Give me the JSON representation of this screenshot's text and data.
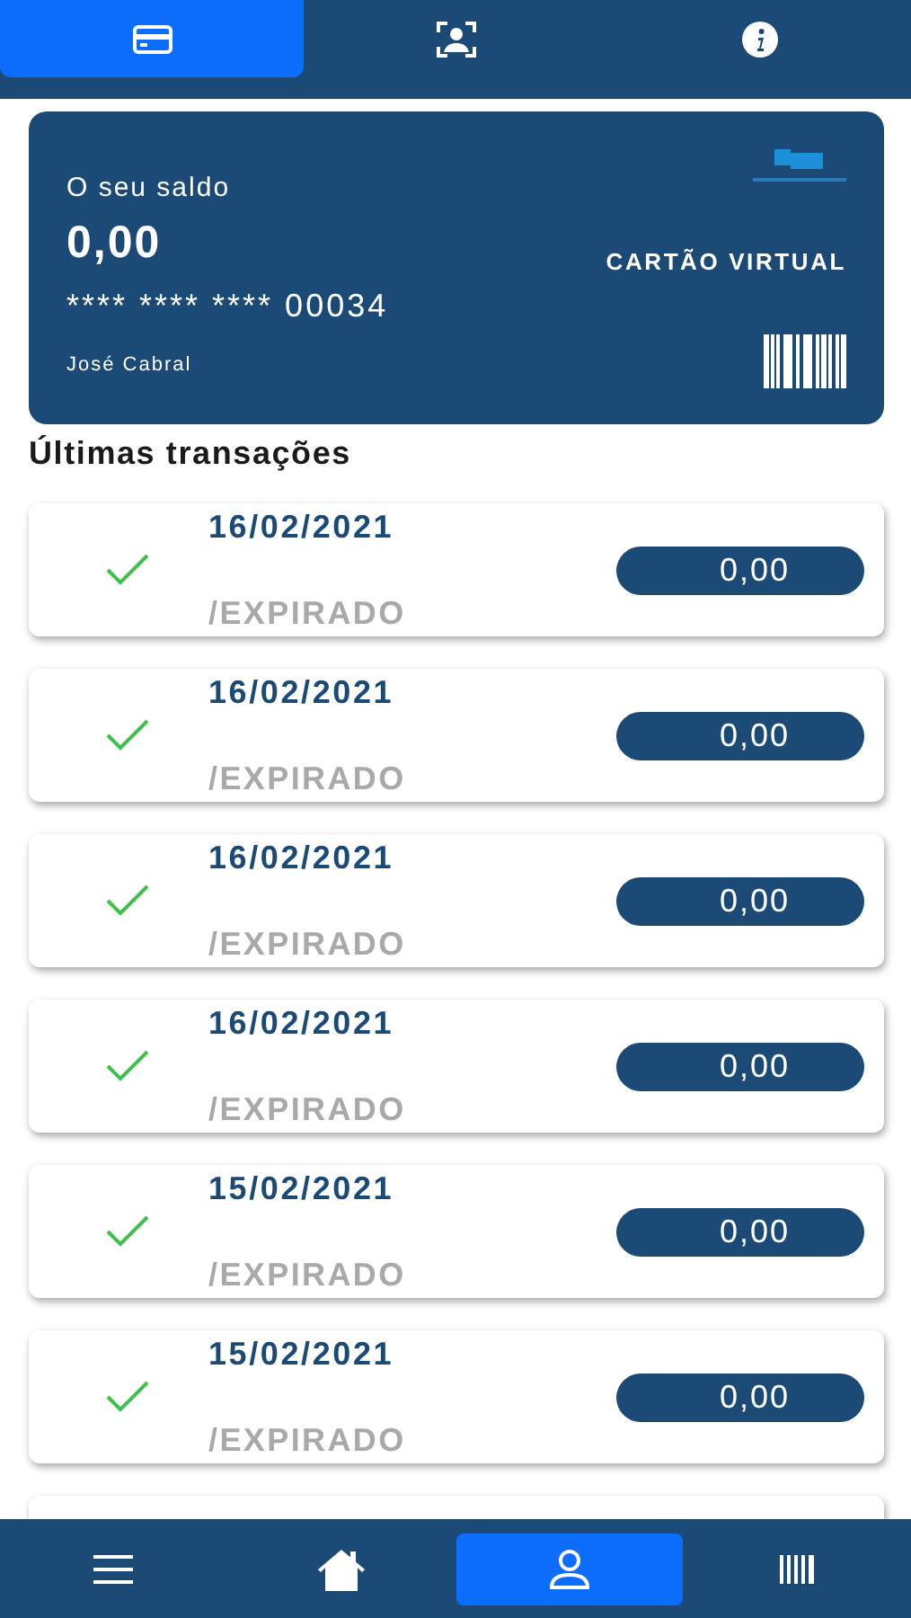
{
  "top_tabs": [
    {
      "selected": true
    },
    {
      "selected": false
    },
    {
      "selected": false
    }
  ],
  "card": {
    "balance_label": "O seu saldo",
    "balance": "0,00",
    "card_number": "**** **** **** 00034",
    "holder": "José Cabral",
    "card_type": "CARTÃO VIRTUAL"
  },
  "transactions_title": "Últimas transações",
  "transactions": [
    {
      "date": "16/02/2021",
      "status": "/EXPIRADO",
      "amount": "0,00"
    },
    {
      "date": "16/02/2021",
      "status": "/EXPIRADO",
      "amount": "0,00"
    },
    {
      "date": "16/02/2021",
      "status": "/EXPIRADO",
      "amount": "0,00"
    },
    {
      "date": "16/02/2021",
      "status": "/EXPIRADO",
      "amount": "0,00"
    },
    {
      "date": "15/02/2021",
      "status": "/EXPIRADO",
      "amount": "0,00"
    },
    {
      "date": "15/02/2021",
      "status": "/EXPIRADO",
      "amount": "0,00"
    }
  ],
  "bottom_nav": [
    {
      "selected": false
    },
    {
      "selected": false
    },
    {
      "selected": true
    },
    {
      "selected": false
    }
  ]
}
